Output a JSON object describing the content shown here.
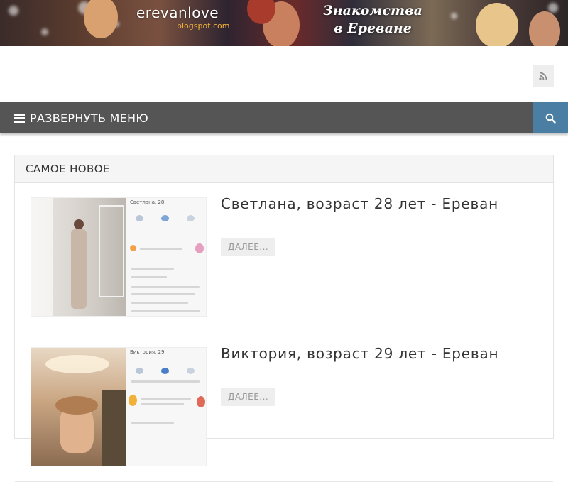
{
  "banner": {
    "logo": "erevanlove",
    "logo_sub": "blogspot.com",
    "slogan": "Знакомства в Ереване"
  },
  "header": {
    "rss_icon": "rss-icon"
  },
  "nav": {
    "menu_label": "РАЗВЕРНУТЬ МЕНЮ",
    "menu_icon": "hamburger-icon",
    "search_icon": "search-icon",
    "accent_color": "#4a7fa3",
    "bar_color": "#555555"
  },
  "widget": {
    "title": "САМОЕ НОВОЕ",
    "posts": [
      {
        "title": "Светлана, возраст 28 лет - Ереван",
        "more_label": "ДАЛЕЕ...",
        "thumb_name": "Светлана, 28"
      },
      {
        "title": "Виктория, возраст 29 лет - Ереван",
        "more_label": "ДАЛЕЕ...",
        "thumb_name": "Виктория, 29"
      }
    ]
  }
}
